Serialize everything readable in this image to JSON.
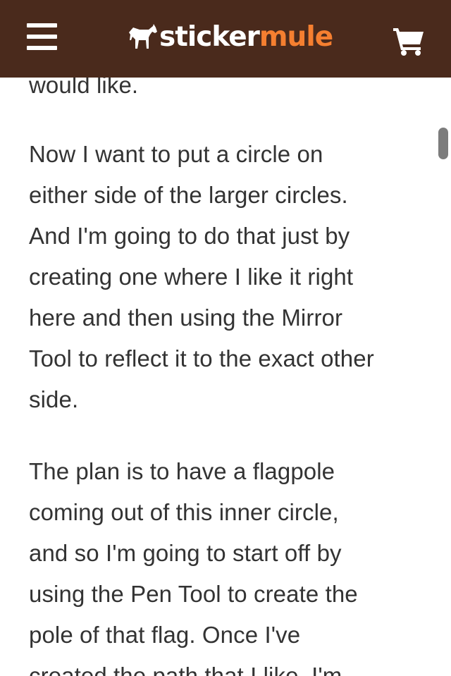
{
  "header": {
    "brand_part1": "sticker",
    "brand_part2": "mule",
    "background": "#4a2a1c",
    "accent": "#f57f30",
    "menu_icon": "hamburger-menu-icon",
    "cart_icon": "shopping-cart-icon",
    "logo_icon": "mule-logo-icon"
  },
  "article": {
    "partial_line": "would like.",
    "paragraph1": [
      "Now I want to put a circle on",
      "either side of the larger circles.",
      "And I'm going to do that just by",
      "creating one where I like it right",
      "here and then using the Mirror",
      "Tool to reflect it to the exact other",
      "side."
    ],
    "paragraph2": [
      "The plan is to have a flagpole",
      "coming out of this inner circle,",
      "and so I'm going to start off by",
      "using the Pen Tool to create the",
      "pole of that flag. Once I've",
      "created the path that I like, I'm"
    ]
  }
}
